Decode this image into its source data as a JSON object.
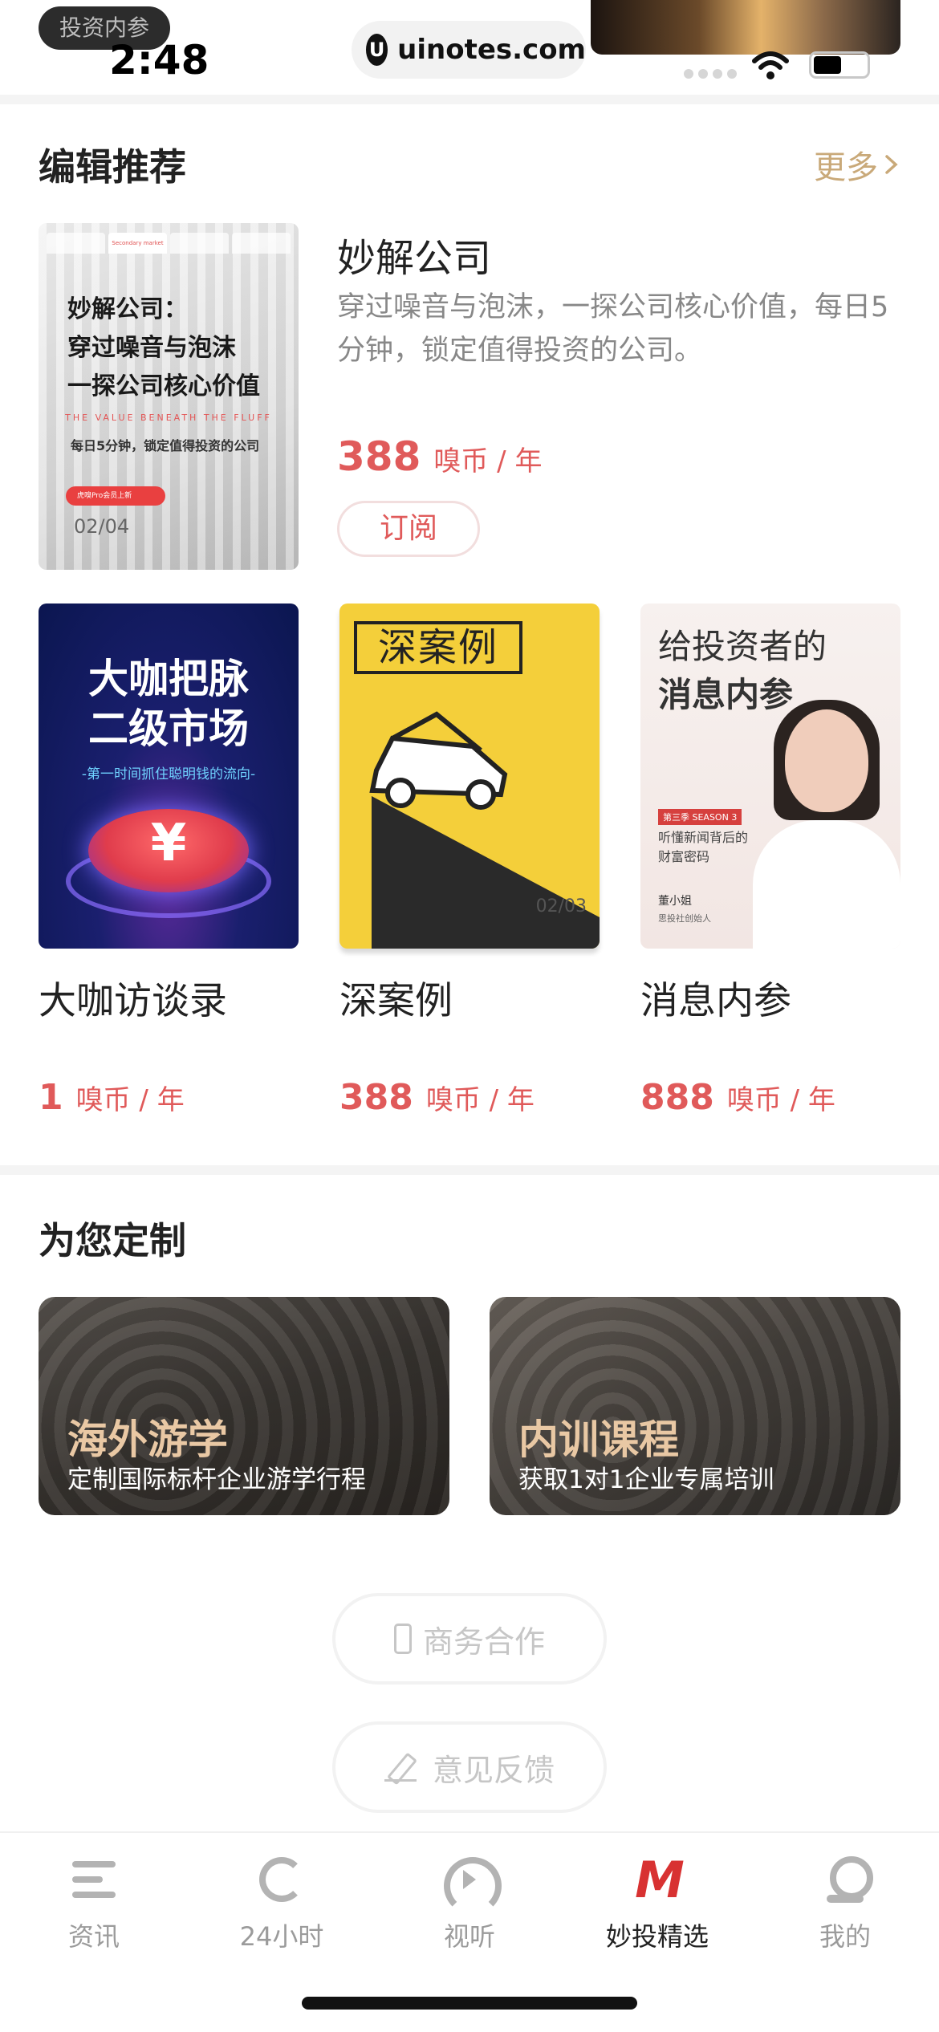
{
  "status_bar": {
    "back_label": "投资内参",
    "time": "2:48",
    "url": "uinotes.com"
  },
  "editor_picks": {
    "title": "编辑推荐",
    "more": "更多",
    "featured": {
      "cover_headline_1": "妙解公司：",
      "cover_headline_2": "穿过噪音与泡沫",
      "cover_headline_3": "一探公司核心价值",
      "cover_english": "THE VALUE BENEATH THE FLUFF",
      "cover_sub": "每日5分钟，锁定值得投资的公司",
      "cover_tab": "Secondary market",
      "cover_pill": "虎嗅Pro会员上新",
      "cover_page": "02/04",
      "name": "妙解公司",
      "desc": "穿过噪音与泡沫，一探公司核心价值，每日5分钟，锁定值得投资的公司。",
      "price": "388",
      "unit": "嗅币 / 年",
      "subscribe": "订阅"
    },
    "products": [
      {
        "name": "大咖访谈录",
        "price": "1",
        "unit": "嗅币 / 年",
        "cover_line1": "大咖把脉",
        "cover_line2": "二级市场",
        "cover_sub": "-第一时间抓住聪明钱的流向-",
        "cover_symbol": "¥"
      },
      {
        "name": "深案例",
        "price": "388",
        "unit": "嗅币 / 年",
        "cover_badge": "深案例",
        "cover_page": "02/03"
      },
      {
        "name": "消息内参",
        "price": "888",
        "unit": "嗅币 / 年",
        "cover_line1": "给投资者的",
        "cover_line2": "消息内参",
        "cover_tag": "第三季 SEASON 3",
        "cover_small1": "听懂新闻背后的",
        "cover_small2": "财富密码",
        "cover_author": "董小姐",
        "cover_role": "思投社创始人"
      }
    ]
  },
  "custom": {
    "title": "为您定制",
    "cards": [
      {
        "title": "海外游学",
        "subtitle": "定制国际标杆企业游学行程"
      },
      {
        "title": "内训课程",
        "subtitle": "获取1对1企业专属培训"
      }
    ]
  },
  "actions": {
    "business": "商务合作",
    "feedback": "意见反馈"
  },
  "tabbar": {
    "items": [
      {
        "label": "资讯",
        "icon": "news-icon"
      },
      {
        "label": "24小时",
        "icon": "refresh-24h-icon"
      },
      {
        "label": "视听",
        "icon": "play-circle-icon"
      },
      {
        "label": "妙投精选",
        "icon": "miaotou-logo-icon",
        "active": true
      },
      {
        "label": "我的",
        "icon": "profile-icon"
      }
    ]
  },
  "colors": {
    "price_red": "#e05a5a",
    "more_gold": "#c9a979",
    "brand_red": "#d83232"
  }
}
